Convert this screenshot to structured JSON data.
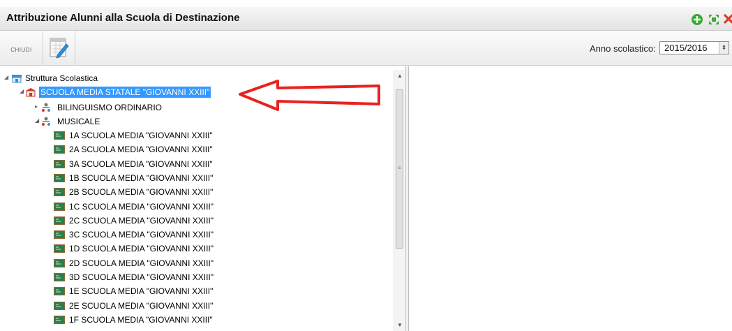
{
  "window": {
    "title": "Attribuzione Alunni alla Scuola di Destinazione",
    "controls": [
      "add-icon",
      "expand-icon",
      "close-icon"
    ]
  },
  "toolbar": {
    "close_label": "CHIUDI",
    "edit_icon": "edit-icon",
    "year_label": "Anno scolastico:",
    "year_value": "2015/2016"
  },
  "tree": {
    "root": "Struttura Scolastica",
    "school": "SCUOLA MEDIA STATALE \"GIOVANNI XXIII\"",
    "groups": [
      "BILINGUISMO ORDINARIO",
      "MUSICALE"
    ],
    "classes": [
      "1A SCUOLA MEDIA \"GIOVANNI XXIII\"",
      "2A SCUOLA MEDIA \"GIOVANNI XXIII\"",
      "3A SCUOLA MEDIA \"GIOVANNI XXIII\"",
      "1B SCUOLA MEDIA \"GIOVANNI XXIII\"",
      "2B SCUOLA MEDIA \"GIOVANNI XXIII\"",
      "1C SCUOLA MEDIA \"GIOVANNI XXIII\"",
      "2C SCUOLA MEDIA \"GIOVANNI XXIII\"",
      "3C SCUOLA MEDIA \"GIOVANNI XXIII\"",
      "1D SCUOLA MEDIA \"GIOVANNI XXIII\"",
      "2D SCUOLA MEDIA \"GIOVANNI XXIII\"",
      "3D SCUOLA MEDIA \"GIOVANNI XXIII\"",
      "1E SCUOLA MEDIA \"GIOVANNI XXIII\"",
      "2E SCUOLA MEDIA \"GIOVANNI XXIII\"",
      "1F SCUOLA MEDIA \"GIOVANNI XXIII\""
    ]
  },
  "colors": {
    "selection": "#3399ff",
    "annotation_arrow": "#e8231f",
    "green_button": "#3aaa35",
    "close_red": "#e03a2e"
  }
}
